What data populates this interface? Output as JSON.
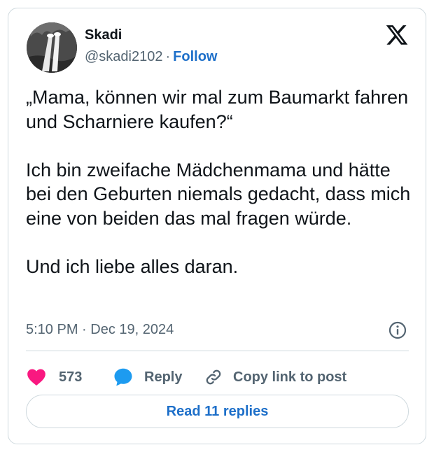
{
  "author": {
    "display_name": "Skadi",
    "handle": "@skadi2102",
    "separator": "·",
    "follow_label": "Follow"
  },
  "brand_icon": "x-logo-icon",
  "tweet": {
    "text": "„Mama, können wir mal zum Baumarkt fahren und Scharniere kaufen?“\n\nIch bin zweifache Mädchenmama und hätte bei den Geburten niemals gedacht, dass mich eine von beiden das mal fragen würde.\n\nUnd ich liebe alles daran.",
    "timestamp": "5:10 PM · Dec 19, 2024"
  },
  "actions": {
    "like_count": "573",
    "reply_label": "Reply",
    "copy_link_label": "Copy link to post"
  },
  "read_replies_label": "Read 11 replies",
  "colors": {
    "accent": "#1d6fc9",
    "heart": "#f91880",
    "reply_bubble": "#1d9bf0",
    "muted": "#536471",
    "border": "#cfd9de"
  }
}
